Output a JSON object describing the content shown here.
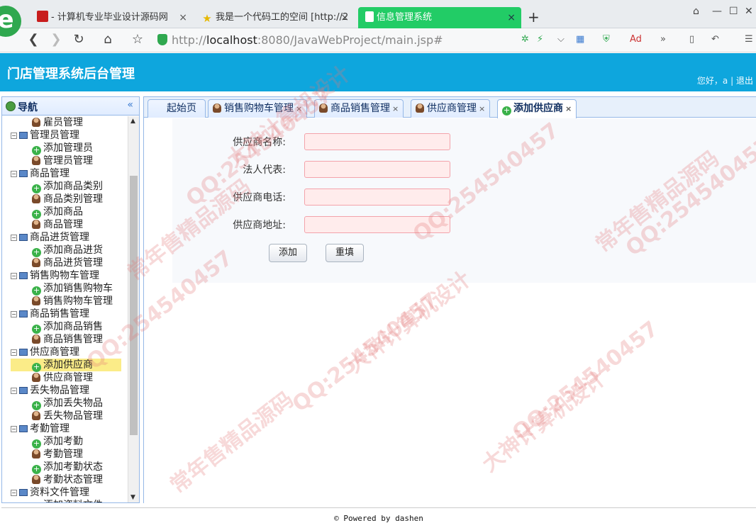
{
  "browser": {
    "tabs": [
      {
        "label": "- 计算机专业毕业设计源码网",
        "close": "×"
      },
      {
        "label": "我是一个代码工的空间 [http://2",
        "close": "×"
      },
      {
        "label": "信息管理系统",
        "close": "×"
      }
    ],
    "new_tab": "+",
    "logo_letter": "e",
    "url_prefix": "http://",
    "url_host": "localhost",
    "url_rest": ":8080/JavaWebProject/main.jsp#",
    "window_controls": [
      "⌂",
      "—",
      "☐",
      "✕"
    ]
  },
  "app": {
    "title": "门店管理系统后台管理",
    "greeting": "您好，a",
    "separator": "|",
    "logout": "退出"
  },
  "sidebar": {
    "title": "导航",
    "collapse": "«",
    "nodes": [
      {
        "type": "child",
        "icon": "user",
        "label": "雇员管理"
      },
      {
        "type": "parent",
        "label": "管理员管理"
      },
      {
        "type": "child",
        "icon": "plus",
        "label": "添加管理员"
      },
      {
        "type": "child",
        "icon": "user",
        "label": "管理员管理"
      },
      {
        "type": "parent",
        "label": "商品管理"
      },
      {
        "type": "child",
        "icon": "plus",
        "label": "添加商品类别"
      },
      {
        "type": "child",
        "icon": "user",
        "label": "商品类别管理"
      },
      {
        "type": "child",
        "icon": "plus",
        "label": "添加商品"
      },
      {
        "type": "child",
        "icon": "user",
        "label": "商品管理"
      },
      {
        "type": "parent",
        "label": "商品进货管理"
      },
      {
        "type": "child",
        "icon": "plus",
        "label": "添加商品进货"
      },
      {
        "type": "child",
        "icon": "user",
        "label": "商品进货管理"
      },
      {
        "type": "parent",
        "label": "销售购物车管理"
      },
      {
        "type": "child",
        "icon": "plus",
        "label": "添加销售购物车"
      },
      {
        "type": "child",
        "icon": "user",
        "label": "销售购物车管理"
      },
      {
        "type": "parent",
        "label": "商品销售管理"
      },
      {
        "type": "child",
        "icon": "plus",
        "label": "添加商品销售"
      },
      {
        "type": "child",
        "icon": "user",
        "label": "商品销售管理"
      },
      {
        "type": "parent",
        "label": "供应商管理"
      },
      {
        "type": "child",
        "icon": "plus",
        "label": "添加供应商",
        "selected": true
      },
      {
        "type": "child",
        "icon": "user",
        "label": "供应商管理"
      },
      {
        "type": "parent",
        "label": "丢失物品管理"
      },
      {
        "type": "child",
        "icon": "plus",
        "label": "添加丢失物品"
      },
      {
        "type": "child",
        "icon": "user",
        "label": "丢失物品管理"
      },
      {
        "type": "parent",
        "label": "考勤管理"
      },
      {
        "type": "child",
        "icon": "plus",
        "label": "添加考勤"
      },
      {
        "type": "child",
        "icon": "user",
        "label": "考勤管理"
      },
      {
        "type": "child",
        "icon": "plus",
        "label": "添加考勤状态"
      },
      {
        "type": "child",
        "icon": "user",
        "label": "考勤状态管理"
      },
      {
        "type": "parent",
        "label": "资料文件管理"
      },
      {
        "type": "child",
        "icon": "plus",
        "label": "添加资料文件"
      }
    ]
  },
  "page_tabs": [
    {
      "label": "起始页",
      "icon": "",
      "closable": false
    },
    {
      "label": "销售购物车管理",
      "icon": "user",
      "closable": true
    },
    {
      "label": "商品销售管理",
      "icon": "user",
      "closable": true
    },
    {
      "label": "供应商管理",
      "icon": "user",
      "closable": true
    },
    {
      "label": "添加供应商",
      "icon": "plus",
      "closable": true,
      "active": true
    }
  ],
  "form": {
    "fields": [
      {
        "label": "供应商名称:",
        "value": ""
      },
      {
        "label": "法人代表:",
        "value": ""
      },
      {
        "label": "供应商电话:",
        "value": ""
      },
      {
        "label": "供应商地址:",
        "value": ""
      }
    ],
    "add_button": "添加",
    "reset_button": "重填"
  },
  "footer": {
    "text": "© Powered by dashen"
  },
  "watermarks": [
    "QQ:254540457",
    "常年售精品源码",
    "大神计算机设计"
  ]
}
